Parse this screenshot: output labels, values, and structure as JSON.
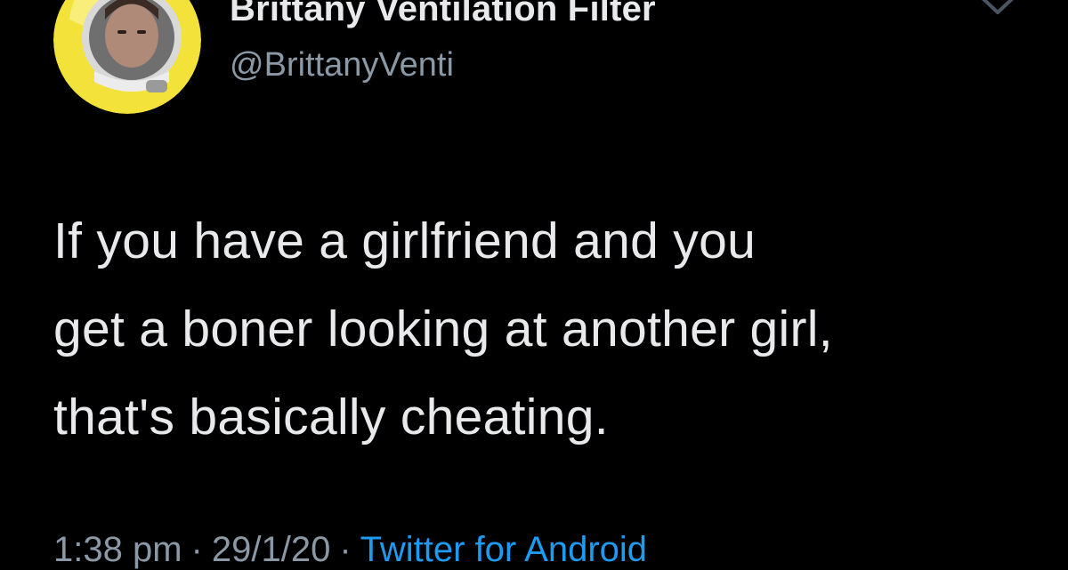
{
  "author": {
    "display_name": "Brittany Ventilation Filter",
    "handle": "@BrittanyVenti",
    "avatar_icon": "profile-photo-astronaut-helmet"
  },
  "tweet": {
    "text": "If you have a girlfriend and you\nget a boner looking at another girl,\nthat's basically cheating."
  },
  "meta": {
    "time": "1:38 pm",
    "separator": "·",
    "date": "29/1/20",
    "source": "Twitter for Android"
  },
  "icons": {
    "menu": "chevron-down-icon"
  },
  "colors": {
    "background": "#000000",
    "text": "#e7e9ea",
    "muted": "#8b98a5",
    "link": "#1d9bf0",
    "avatar_ring": "#f3e23a"
  }
}
